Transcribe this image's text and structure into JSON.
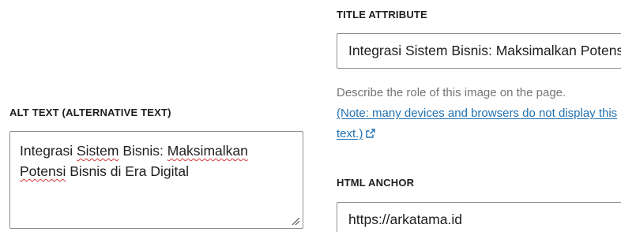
{
  "alt_text": {
    "label": "ALT TEXT (ALTERNATIVE TEXT)",
    "value_parts": [
      "Integrasi ",
      "Sistem",
      " Bisnis: ",
      "Maksimalkan",
      " ",
      "Potensi",
      " Bisnis di Era Digital"
    ]
  },
  "title_attribute": {
    "label": "TITLE ATTRIBUTE",
    "value": "Integrasi Sistem Bisnis: Maksimalkan Potensi Bisnis di Era Digital"
  },
  "help": {
    "description": "Describe the role of this image on the page.",
    "link_text": "(Note: many devices and browsers do not display this text.)"
  },
  "html_anchor": {
    "label": "HTML ANCHOR",
    "value": "https://arkatama.id"
  },
  "colors": {
    "link": "#2271b1",
    "spellcheck_underline": "#d63638",
    "border": "#8c8f94"
  },
  "icons": [
    "external-link-icon",
    "resize-grip-icon"
  ]
}
